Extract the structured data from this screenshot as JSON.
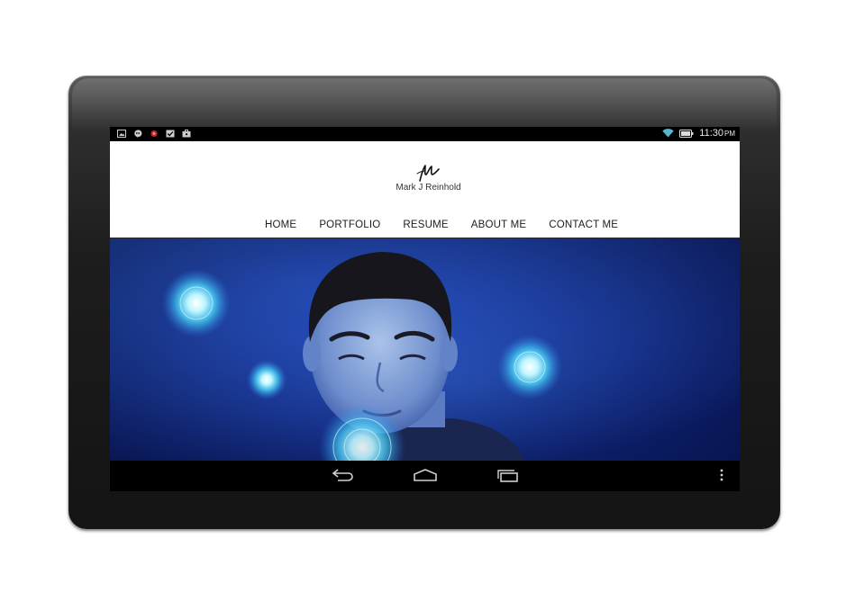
{
  "status_bar": {
    "left_icons": [
      "gallery-icon",
      "hangouts-icon",
      "record-icon",
      "checkbox-icon",
      "briefcase-icon"
    ],
    "right_icons": [
      "wifi-icon",
      "battery-icon"
    ],
    "time": "11:30",
    "ampm": "PM"
  },
  "site": {
    "name": "Mark J Reinhold",
    "nav": [
      "HOME",
      "PORTFOLIO",
      "RESUME",
      "ABOUT ME",
      "CONTACT ME"
    ]
  },
  "colors": {
    "hero_blue": "#1a3aa8",
    "glow": "#7fe8ff"
  },
  "android_nav": {
    "buttons": [
      "back-icon",
      "home-icon",
      "recents-icon",
      "overflow-menu-icon"
    ]
  }
}
